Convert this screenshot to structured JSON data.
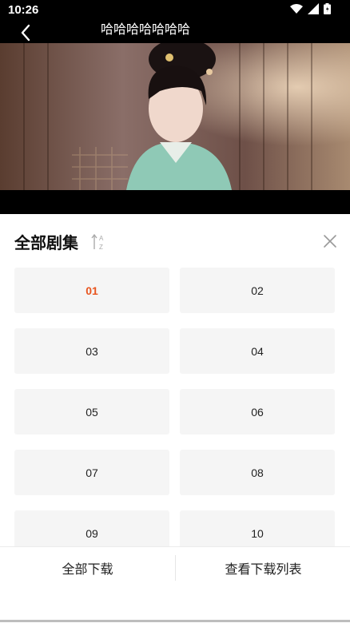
{
  "status_bar": {
    "time": "10:26",
    "icons": [
      "wifi-icon",
      "signal-icon",
      "battery-icon"
    ]
  },
  "header": {
    "title": "哈哈哈哈哈哈哈",
    "back_icon": "back-arrow-icon"
  },
  "video": {
    "description_icon": "video-frame"
  },
  "sheet": {
    "title": "全部剧集",
    "sort_icon": "sort-az-icon",
    "close_icon": "close-icon",
    "episodes": [
      {
        "label": "01",
        "active": true
      },
      {
        "label": "02",
        "active": false
      },
      {
        "label": "03",
        "active": false
      },
      {
        "label": "04",
        "active": false
      },
      {
        "label": "05",
        "active": false
      },
      {
        "label": "06",
        "active": false
      },
      {
        "label": "07",
        "active": false
      },
      {
        "label": "08",
        "active": false
      },
      {
        "label": "09",
        "active": false
      },
      {
        "label": "10",
        "active": false
      }
    ]
  },
  "footer": {
    "download_all": "全部下载",
    "view_downloads": "查看下载列表"
  },
  "colors": {
    "accent": "#e8551f",
    "cell_bg": "#f5f5f5",
    "bar_bg": "#000000"
  }
}
